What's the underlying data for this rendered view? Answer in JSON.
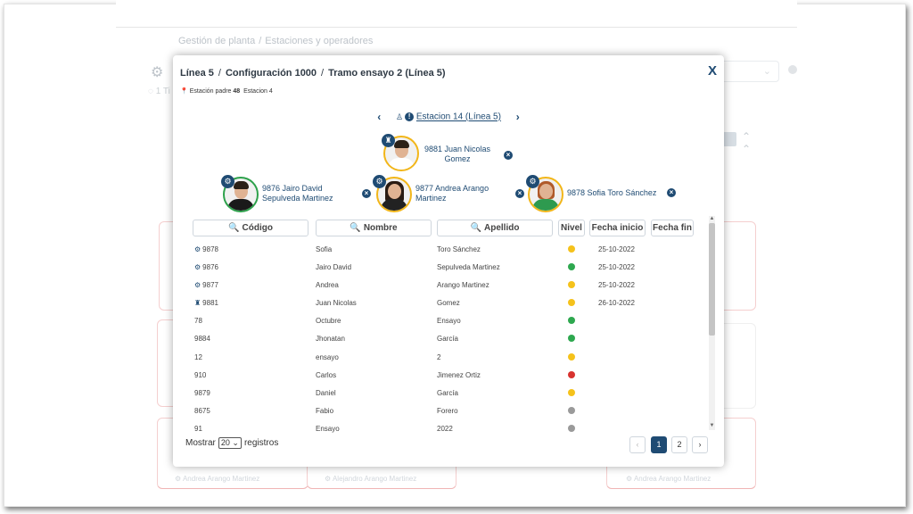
{
  "background": {
    "breadcrumb": [
      "Gestión de planta",
      "Estaciones y operadores"
    ],
    "ti_text": "1 Ti",
    "card_footers": [
      "Andrea Arango Martinez",
      "Alejandro Arango Martinez",
      "Andrea Arango Martinez"
    ]
  },
  "modal": {
    "title": [
      "Línea 5",
      "Configuración 1000",
      "Tramo ensayo 2 (Línea 5)"
    ],
    "close_label": "X",
    "subtitle": {
      "label": "Estación padre",
      "number": "48",
      "station": "Estacion 4"
    },
    "station_link": "Estacion 14 (Línea 5)"
  },
  "operators": [
    {
      "text": "9881 Juan Nicolas\nGomez",
      "line1": "9881 Juan Nicolas",
      "line2": "Gomez",
      "role": "leader",
      "ring": "yellow"
    },
    {
      "line1": "9876 Jairo David",
      "line2": "Sepulveda Martinez",
      "role": "operator",
      "ring": "green"
    },
    {
      "line1": "9877 Andrea Arango",
      "line2": "Martinez",
      "role": "operator",
      "ring": "yellow"
    },
    {
      "line1": "9878 Sofia Toro Sánchez",
      "line2": "",
      "role": "operator",
      "ring": "yellow"
    }
  ],
  "filters": {
    "codigo": "Código",
    "nombre": "Nombre",
    "apellido": "Apellido",
    "nivel": "Nivel",
    "fecha_inicio": "Fecha inicio",
    "fecha_fin": "Fecha fin"
  },
  "table": [
    {
      "icon": "gear",
      "code": "9878",
      "name": "Sofia",
      "last": "Toro Sánchez",
      "level": "yellow",
      "start": "25-10-2022"
    },
    {
      "icon": "gear",
      "code": "9876",
      "name": "Jairo David",
      "last": "Sepulveda Martinez",
      "level": "green",
      "start": "25-10-2022"
    },
    {
      "icon": "gear",
      "code": "9877",
      "name": "Andrea",
      "last": "Arango Martinez",
      "level": "yellow",
      "start": "25-10-2022"
    },
    {
      "icon": "leader",
      "code": "9881",
      "name": "Juan Nicolas",
      "last": "Gomez",
      "level": "yellow",
      "start": "26-10-2022"
    },
    {
      "icon": "",
      "code": "78",
      "name": "Octubre",
      "last": "Ensayo",
      "level": "green",
      "start": ""
    },
    {
      "icon": "",
      "code": "9884",
      "name": "Jhonatan",
      "last": "García",
      "level": "green",
      "start": ""
    },
    {
      "icon": "",
      "code": "12",
      "name": "ensayo",
      "last": "2",
      "level": "yellow",
      "start": ""
    },
    {
      "icon": "",
      "code": "910",
      "name": "Carlos",
      "last": "Jimenez Ortiz",
      "level": "red",
      "start": ""
    },
    {
      "icon": "",
      "code": "9879",
      "name": "Daniel",
      "last": "García",
      "level": "yellow",
      "start": ""
    },
    {
      "icon": "",
      "code": "8675",
      "name": "Fabio",
      "last": "Forero",
      "level": "grey",
      "start": ""
    },
    {
      "icon": "",
      "code": "91",
      "name": "Ensayo",
      "last": "2022",
      "level": "grey",
      "start": ""
    }
  ],
  "footer": {
    "show_label": "Mostrar",
    "page_size": "20",
    "records_label": "registros"
  },
  "pagination": {
    "prev": "‹",
    "pages": [
      "1",
      "2"
    ],
    "active": "1",
    "next": "›"
  },
  "colors": {
    "primary": "#1f4b73",
    "yellow": "#f5c21b",
    "green": "#2ea84f",
    "red": "#d8332f",
    "grey": "#9a9a9a"
  }
}
